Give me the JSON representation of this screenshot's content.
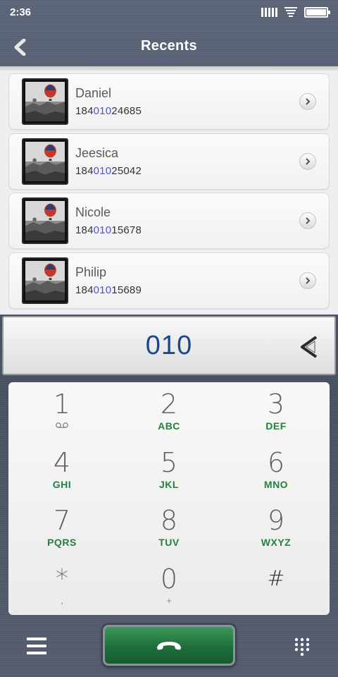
{
  "status_bar": {
    "time": "2:36"
  },
  "header": {
    "title": "Recents"
  },
  "contacts": [
    {
      "name": "Daniel",
      "number_prefix": "184",
      "number_match": "010",
      "number_suffix": "24685"
    },
    {
      "name": "Jeesica",
      "number_prefix": "184",
      "number_match": "010",
      "number_suffix": "25042"
    },
    {
      "name": "Nicole",
      "number_prefix": "184",
      "number_match": "010",
      "number_suffix": "15678"
    },
    {
      "name": "Philip",
      "number_prefix": "184",
      "number_match": "010",
      "number_suffix": "15689"
    }
  ],
  "dialed_number": "010",
  "keypad": [
    {
      "digit": "1",
      "letters": "",
      "sub": "voicemail-icon"
    },
    {
      "digit": "2",
      "letters": "ABC"
    },
    {
      "digit": "3",
      "letters": "DEF"
    },
    {
      "digit": "4",
      "letters": "GHI"
    },
    {
      "digit": "5",
      "letters": "JKL"
    },
    {
      "digit": "6",
      "letters": "MNO"
    },
    {
      "digit": "7",
      "letters": "PQRS"
    },
    {
      "digit": "8",
      "letters": "TUV"
    },
    {
      "digit": "9",
      "letters": "WXYZ"
    },
    {
      "digit": "*",
      "letters": "",
      "sub": ","
    },
    {
      "digit": "0",
      "letters": "",
      "sub": "+"
    },
    {
      "digit": "#",
      "letters": ""
    }
  ],
  "icons": {
    "back": "back-arrow-icon",
    "detail": "chevron-right-icon",
    "backspace": "backspace-icon",
    "menu": "menu-icon",
    "call": "phone-handset-icon",
    "dialpad": "dialpad-icon"
  },
  "colors": {
    "call_green": "#1f6e3a",
    "letters_green": "#23813c",
    "number_blue": "#164a8e",
    "match_highlight": "#4f4fe0"
  }
}
